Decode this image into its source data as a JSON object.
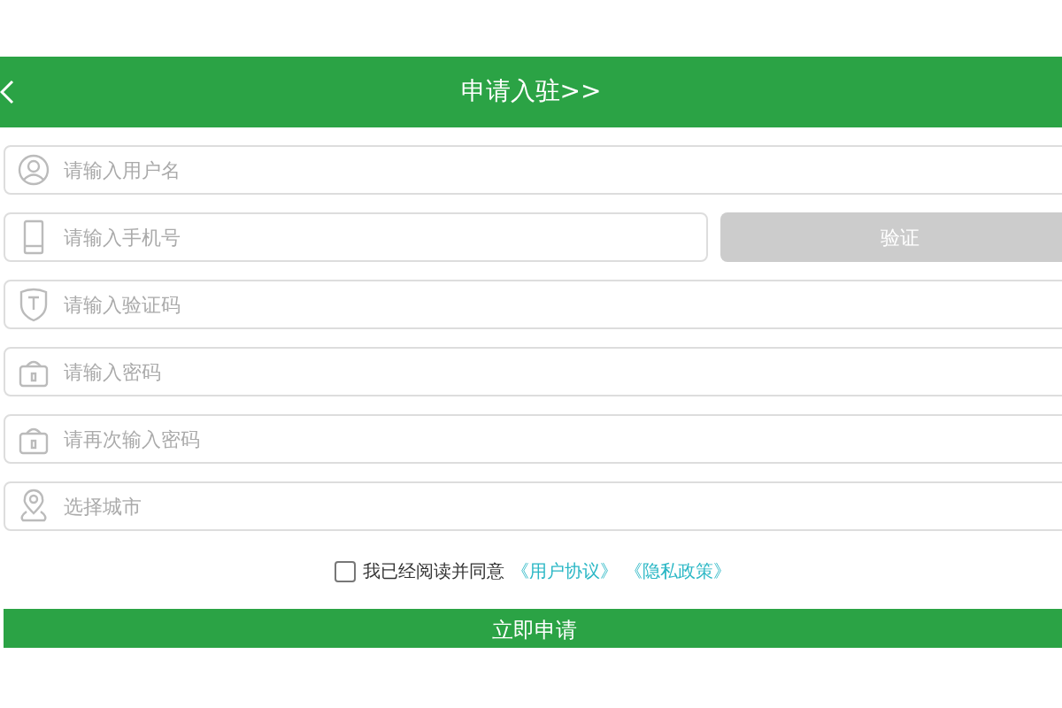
{
  "header": {
    "title": "申请入驻>>"
  },
  "fields": [
    {
      "kind": "user",
      "placeholder": "请输入用户名"
    },
    {
      "kind": "phone",
      "placeholder": "请输入手机号",
      "action": "验证",
      "action_disabled": true
    },
    {
      "kind": "shield",
      "placeholder": "请输入验证码"
    },
    {
      "kind": "lock",
      "placeholder": "请输入密码"
    },
    {
      "kind": "lock",
      "placeholder": "请再次输入密码"
    },
    {
      "kind": "pin",
      "placeholder": "选择城市"
    }
  ],
  "agreement": {
    "checked": false,
    "text": "我已经阅读并同意",
    "links": [
      "《用户协议》",
      "《隐私政策》"
    ]
  },
  "submit": "立即申请"
}
